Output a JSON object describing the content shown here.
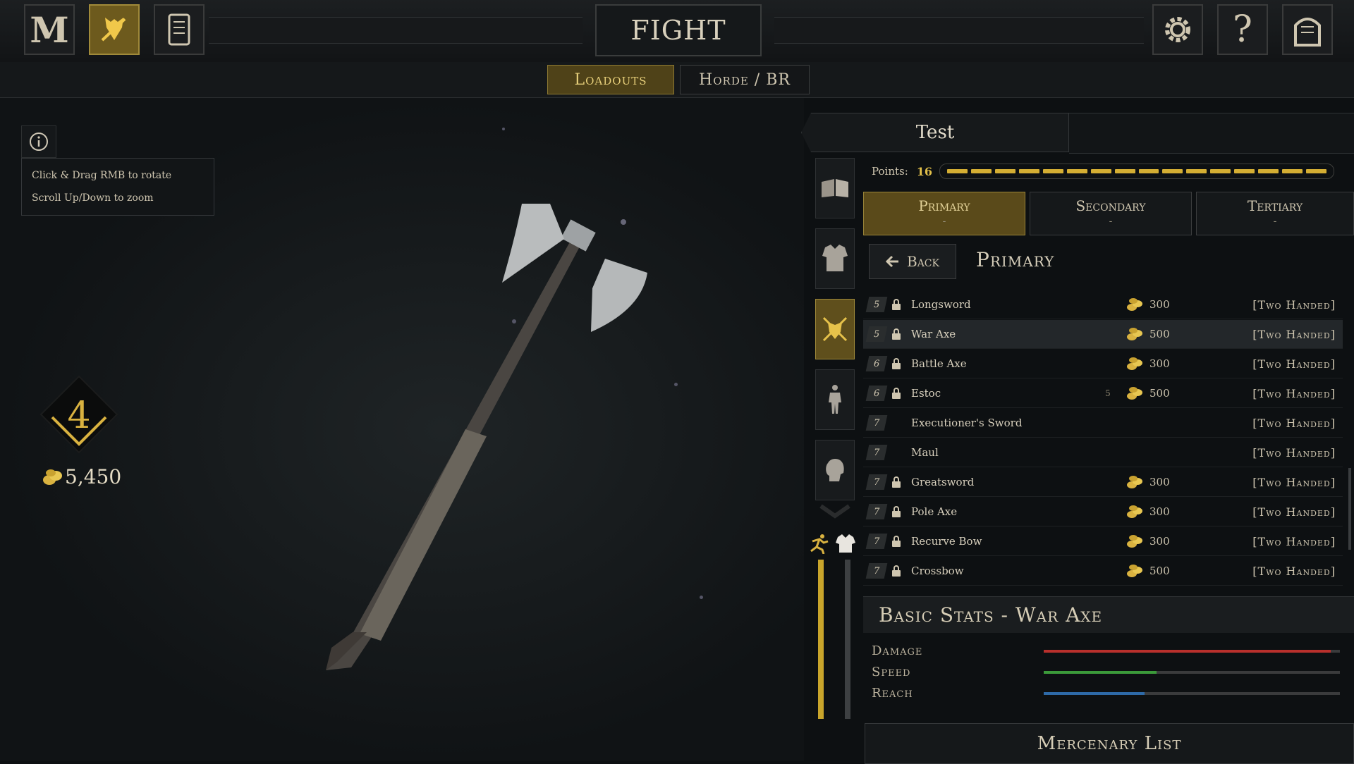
{
  "topbar": {
    "logo_letter": "M",
    "title": "FIGHT",
    "help_glyph": "?"
  },
  "tabs": [
    {
      "label": "Loadouts",
      "active": true
    },
    {
      "label": "Horde / BR",
      "active": false
    }
  ],
  "viewer": {
    "hint_lines": [
      "Click & Drag RMB to rotate",
      "Scroll Up/Down to zoom"
    ]
  },
  "player": {
    "level": "4",
    "gold": "5,450"
  },
  "loadout": {
    "name": "Test",
    "points_label": "Points:",
    "points_value": "16",
    "points_total_segments": 16
  },
  "slots": [
    {
      "label": "Primary",
      "value": "-",
      "active": true
    },
    {
      "label": "Secondary",
      "value": "-",
      "active": false
    },
    {
      "label": "Tertiary",
      "value": "-",
      "active": false
    }
  ],
  "list_header": {
    "back_label": "Back",
    "title": "Primary"
  },
  "weapons": [
    {
      "tier": "5",
      "locked": true,
      "name": "Longsword",
      "price": "300",
      "type": "[Two Handed]",
      "selected": false
    },
    {
      "tier": "5",
      "locked": true,
      "name": "War Axe",
      "price": "500",
      "type": "[Two Handed]",
      "selected": true
    },
    {
      "tier": "6",
      "locked": true,
      "name": "Battle Axe",
      "price": "300",
      "type": "[Two Handed]",
      "selected": false
    },
    {
      "tier": "6",
      "locked": true,
      "name": "Estoc",
      "price": "500",
      "type": "[Two Handed]",
      "selected": false,
      "req_level": "5"
    },
    {
      "tier": "7",
      "locked": false,
      "name": "Executioner's Sword",
      "price": "",
      "type": "[Two Handed]",
      "selected": false
    },
    {
      "tier": "7",
      "locked": false,
      "name": "Maul",
      "price": "",
      "type": "[Two Handed]",
      "selected": false
    },
    {
      "tier": "7",
      "locked": true,
      "name": "Greatsword",
      "price": "300",
      "type": "[Two Handed]",
      "selected": false
    },
    {
      "tier": "7",
      "locked": true,
      "name": "Pole Axe",
      "price": "300",
      "type": "[Two Handed]",
      "selected": false
    },
    {
      "tier": "7",
      "locked": true,
      "name": "Recurve Bow",
      "price": "300",
      "type": "[Two Handed]",
      "selected": false
    },
    {
      "tier": "7",
      "locked": true,
      "name": "Crossbow",
      "price": "500",
      "type": "[Two Handed]",
      "selected": false
    }
  ],
  "stats": {
    "title": "Basic Stats - War Axe",
    "items": [
      {
        "label": "Damage",
        "value": 0.97,
        "color": "#b8302c"
      },
      {
        "label": "Speed",
        "value": 0.38,
        "color": "#3b9a3a"
      },
      {
        "label": "Reach",
        "value": 0.34,
        "color": "#2e6aa8"
      }
    ]
  },
  "footer": {
    "mercenary_label": "Mercenary List"
  },
  "colors": {
    "accent_gold": "#d4ae33",
    "active_tab_bg": "#5a4a1a"
  }
}
